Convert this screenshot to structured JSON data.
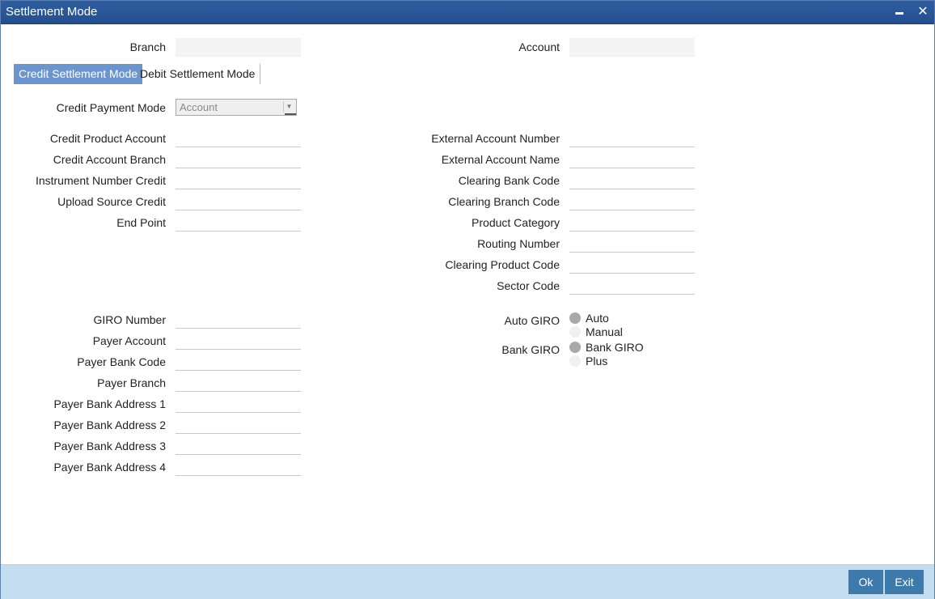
{
  "window": {
    "title": "Settlement Mode",
    "minimize_icon": "minimize-icon",
    "close_icon": "close-icon",
    "close_glyph": "✕"
  },
  "header": {
    "branch_label": "Branch",
    "branch_value": "",
    "account_label": "Account",
    "account_value": ""
  },
  "tabs": [
    {
      "label": "Credit Settlement Mode",
      "active": true
    },
    {
      "label": "Debit Settlement Mode",
      "active": false
    }
  ],
  "credit": {
    "payment_mode_label": "Credit Payment Mode",
    "payment_mode_value": "Account",
    "left_fields": [
      {
        "label": "Credit Product Account",
        "value": ""
      },
      {
        "label": "Credit Account Branch",
        "value": ""
      },
      {
        "label": "Instrument Number Credit",
        "value": ""
      },
      {
        "label": "Upload Source Credit",
        "value": ""
      },
      {
        "label": "End Point",
        "value": ""
      }
    ],
    "right_fields": [
      {
        "label": "External Account Number",
        "value": ""
      },
      {
        "label": "External Account Name",
        "value": ""
      },
      {
        "label": "Clearing Bank Code",
        "value": ""
      },
      {
        "label": "Clearing Branch Code",
        "value": ""
      },
      {
        "label": "Product Category",
        "value": ""
      },
      {
        "label": "Routing Number",
        "value": ""
      },
      {
        "label": "Clearing Product Code",
        "value": ""
      },
      {
        "label": "Sector Code",
        "value": ""
      }
    ],
    "giro_fields": [
      {
        "label": "GIRO Number",
        "value": ""
      },
      {
        "label": "Payer Account",
        "value": ""
      },
      {
        "label": "Payer Bank Code",
        "value": ""
      },
      {
        "label": "Payer Branch",
        "value": ""
      },
      {
        "label": "Payer Bank Address 1",
        "value": ""
      },
      {
        "label": "Payer Bank Address 2",
        "value": ""
      },
      {
        "label": "Payer Bank Address 3",
        "value": ""
      },
      {
        "label": "Payer Bank Address 4",
        "value": ""
      }
    ],
    "auto_giro": {
      "label": "Auto GIRO",
      "options": [
        "Auto",
        "Manual"
      ],
      "selected": "Auto"
    },
    "bank_giro": {
      "label": "Bank GIRO",
      "options": [
        "Bank GIRO",
        "Plus"
      ],
      "selected": "Bank GIRO"
    }
  },
  "footer": {
    "ok_label": "Ok",
    "exit_label": "Exit"
  }
}
